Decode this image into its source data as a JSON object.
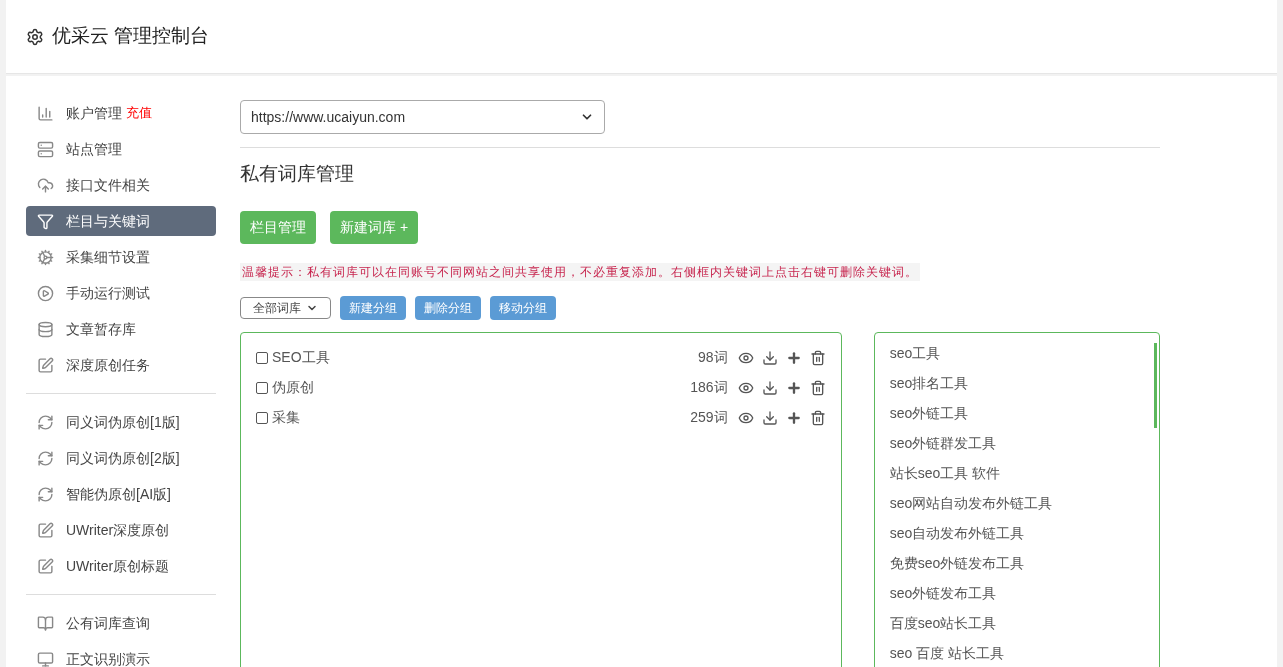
{
  "header": {
    "title": "优采云 管理控制台"
  },
  "sidebar": {
    "groups": [
      {
        "items": [
          {
            "label": "账户管理",
            "badge": "充值",
            "selected": false
          },
          {
            "label": "站点管理",
            "selected": false
          },
          {
            "label": "接口文件相关",
            "selected": false
          },
          {
            "label": "栏目与关键词",
            "selected": true
          },
          {
            "label": "采集细节设置",
            "selected": false
          },
          {
            "label": "手动运行测试",
            "selected": false
          },
          {
            "label": "文章暂存库",
            "selected": false
          },
          {
            "label": "深度原创任务",
            "selected": false
          }
        ]
      },
      {
        "items": [
          {
            "label": "同义词伪原创[1版]",
            "selected": false
          },
          {
            "label": "同义词伪原创[2版]",
            "selected": false
          },
          {
            "label": "智能伪原创[AI版]",
            "selected": false
          },
          {
            "label": "UWriter深度原创",
            "selected": false
          },
          {
            "label": "UWriter原创标题",
            "selected": false
          }
        ]
      },
      {
        "items": [
          {
            "label": "公有词库查询",
            "selected": false
          },
          {
            "label": "正文识别演示",
            "selected": false
          }
        ]
      }
    ]
  },
  "site_select": {
    "value": "https://www.ucaiyun.com"
  },
  "section_title": "私有词库管理",
  "buttons": [
    {
      "label": "栏目管理",
      "kind": "green"
    },
    {
      "label": "新建词库 +",
      "kind": "green"
    }
  ],
  "tip": "温馨提示：私有词库可以在同账号不同网站之间共享使用，不必重复添加。右侧框内关键词上点击右键可删除关键词。",
  "group_select": {
    "value": "全部词库"
  },
  "group_buttons": [
    "新建分组",
    "删除分组",
    "移动分组"
  ],
  "libraries": [
    {
      "name": "SEO工具",
      "count": "98词",
      "checked": false
    },
    {
      "name": "伪原创",
      "count": "186词",
      "checked": false
    },
    {
      "name": "采集",
      "count": "259词",
      "checked": false
    }
  ],
  "keywords": [
    "seo工具",
    "seo排名工具",
    "seo外链工具",
    "seo外链群发工具",
    "站长seo工具 软件",
    "seo网站自动发布外链工具",
    "seo自动发布外链工具",
    "免费seo外链发布工具",
    "seo外链发布工具",
    "百度seo站长工具",
    "seo 百度 站长工具"
  ]
}
